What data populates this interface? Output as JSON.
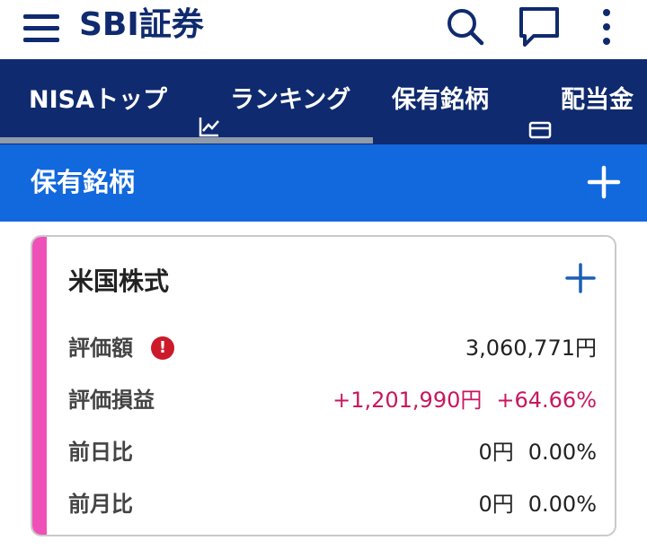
{
  "header": {
    "logo_text": "SBI証券"
  },
  "icons": {
    "menu": "hamburger-menu-icon",
    "search": "search-icon",
    "chat": "chat-bubble-icon",
    "more": "more-vertical-icon"
  },
  "nav": {
    "tabs": [
      {
        "label": "NISAトップ",
        "icon": ""
      },
      {
        "label": "ランキング",
        "icon": "chart-line-icon"
      },
      {
        "label": "保有銘柄",
        "icon": ""
      },
      {
        "label": "配当金",
        "icon": "card-icon"
      }
    ],
    "selected_index": 0
  },
  "section": {
    "title": "保有銘柄"
  },
  "card": {
    "title": "米国株式",
    "rows": [
      {
        "label": "評価額",
        "value": "3,060,771円",
        "alert": true
      },
      {
        "label": "評価損益",
        "value": "+1,201,990円",
        "value2": "+64.66%"
      },
      {
        "label": "前日比",
        "value": "0円",
        "value2": "0.00%"
      },
      {
        "label": "前月比",
        "value": "0円",
        "value2": "0.00%"
      }
    ]
  },
  "colors": {
    "navy": "#0f2a6e",
    "section_blue": "#1268dd",
    "accent_pink": "#ee50b7",
    "gain_pink": "#c8175f",
    "alert_red": "#cc1a2a"
  }
}
